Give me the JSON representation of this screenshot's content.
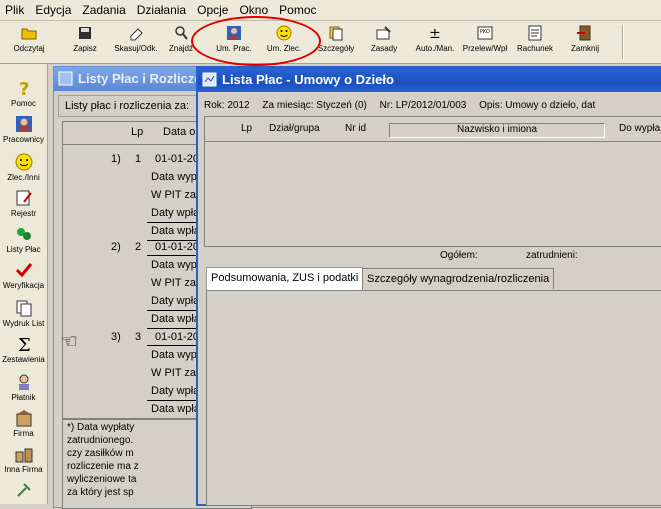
{
  "menu": [
    "Plik",
    "Edycja",
    "Zadania",
    "Działania",
    "Opcje",
    "Okno",
    "Pomoc"
  ],
  "toolbar": [
    {
      "label": "Odczytaj",
      "icon": "open-icon"
    },
    {
      "label": "Zapisz",
      "icon": "save-icon"
    },
    {
      "label": "Skasuj/Odk.",
      "icon": "eraser-icon"
    },
    {
      "label": "Znajdź",
      "icon": "find-icon"
    },
    {
      "label": "Um. Prac.",
      "icon": "employee-contract-icon"
    },
    {
      "label": "Um. Zlec.",
      "icon": "smiley-contract-icon"
    },
    {
      "label": "Szczegóły",
      "icon": "details-icon"
    },
    {
      "label": "Zasady",
      "icon": "rules-icon"
    },
    {
      "label": "Auto./Man.",
      "icon": "auto-manual-icon"
    },
    {
      "label": "Przelew/Wpł",
      "icon": "transfer-icon"
    },
    {
      "label": "Rachunek",
      "icon": "invoice-icon"
    },
    {
      "label": "Zamknij",
      "icon": "close-door-icon"
    }
  ],
  "sidebar": [
    {
      "label": "Pomoc",
      "icon": "question-icon"
    },
    {
      "label": "Pracownicy",
      "icon": "employee-icon"
    },
    {
      "label": "Zlec./Inni",
      "icon": "smiley-icon"
    },
    {
      "label": "Rejestr",
      "icon": "register-icon"
    },
    {
      "label": "Listy Płac",
      "icon": "payroll-icon"
    },
    {
      "label": "Weryfikacja",
      "icon": "checkmark-icon"
    },
    {
      "label": "Wydruk List",
      "icon": "print-icon"
    },
    {
      "label": "Zestawienia",
      "icon": "sigma-icon"
    },
    {
      "label": "Płatnik",
      "icon": "payer-icon"
    },
    {
      "label": "Firma",
      "icon": "company-icon"
    },
    {
      "label": "Inna Firma",
      "icon": "other-company-icon"
    },
    {
      "label": "",
      "icon": "tools-icon"
    }
  ],
  "back_window": {
    "title": "Listy Płac i Rozliczeń",
    "subtitle": "Listy płac i rozliczenia za:",
    "col_lp": "Lp",
    "col_data": "Data o",
    "entries": [
      {
        "idx": "1)",
        "lp": "1",
        "date": "01-01-201",
        "lines": [
          "Data wypł",
          "W PIT za",
          "Daty wpła",
          "Data wpła"
        ]
      },
      {
        "idx": "2)",
        "lp": "2",
        "date": "01-01-201",
        "lines": [
          "Data wypł",
          "W PIT za",
          "Daty wpła",
          "Data wpła"
        ]
      },
      {
        "idx": "3)",
        "lp": "3",
        "date": "01-01-201",
        "lines": [
          "Data wypł",
          "W PIT za",
          "Daty wpła",
          "Data wpła"
        ]
      }
    ],
    "note": [
      "*) Data wypłaty",
      "zatrudnionego.",
      "czy zasiłków m",
      "rozliczenie ma z",
      "wyliczeniowe ta",
      "za który jest sp"
    ]
  },
  "front_window": {
    "title": "Lista Płac - Umowy o Dzieło",
    "rok": "Rok: 2012",
    "za_miesiac": "Za miesiąc: Styczeń (0)",
    "nr": "Nr: LP/2012/01/003",
    "opis": "Opis:  Umowy o dzieło, dat",
    "columns": {
      "lp": "Lp",
      "dzial": "Dział/grupa",
      "nrid": "Nr id",
      "nazwisko": "Nazwisko i imiona",
      "wyplata": "Do wypła"
    },
    "footer": {
      "ogolem": "Ogółem:",
      "zatrudnieni": "zatrudnieni:"
    },
    "tabs": [
      "Podsumowania, ZUS i podatki",
      "Szczegóły wynagrodzenia/rozliczenia"
    ]
  },
  "colors": {
    "title_active": "#1b4fbf",
    "title_inactive": "#7da7e6",
    "annotation": "#e00000"
  }
}
